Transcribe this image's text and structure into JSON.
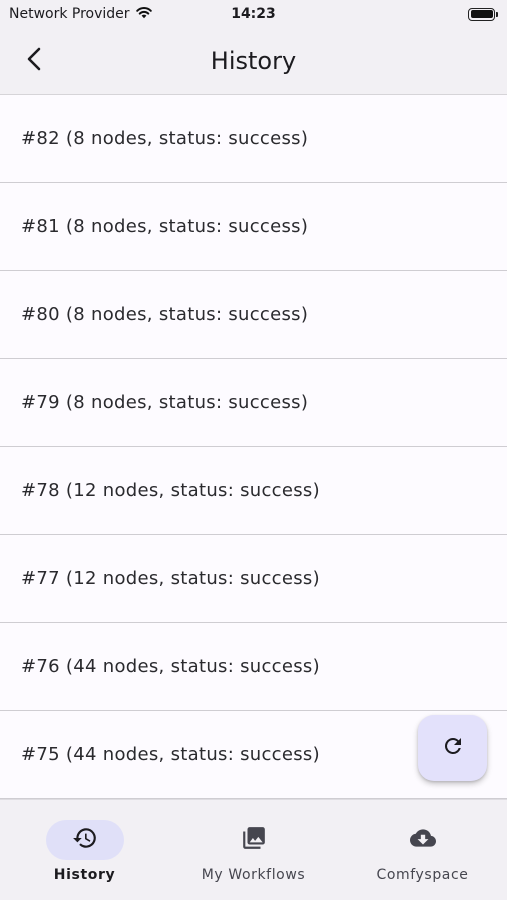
{
  "status_bar": {
    "carrier": "Network Provider",
    "time": "14:23",
    "icons": [
      "wifi-icon",
      "battery-icon"
    ]
  },
  "header": {
    "title": "History",
    "back_icon": "chevron-left-icon"
  },
  "history": [
    "#82 (8 nodes, status: success)",
    "#81 (8 nodes, status: success)",
    "#80 (8 nodes, status: success)",
    "#79 (8 nodes, status: success)",
    "#78 (12 nodes, status: success)",
    "#77 (12 nodes, status: success)",
    "#76 (44 nodes, status: success)",
    "#75 (44 nodes, status: success)"
  ],
  "fab": {
    "icon": "refresh-icon"
  },
  "bottom_nav": [
    {
      "label": "History",
      "icon": "history-icon",
      "active": true
    },
    {
      "label": "My Workflows",
      "icon": "photo-library-icon",
      "active": false
    },
    {
      "label": "Comfyspace",
      "icon": "cloud-download-icon",
      "active": false
    }
  ],
  "colors": {
    "background": "#fdfbff",
    "bar_background": "#f2f0f4",
    "active_indicator": "#e0e0f8",
    "fab_background": "#e3e1fb",
    "divider": "#cfcdd2"
  }
}
